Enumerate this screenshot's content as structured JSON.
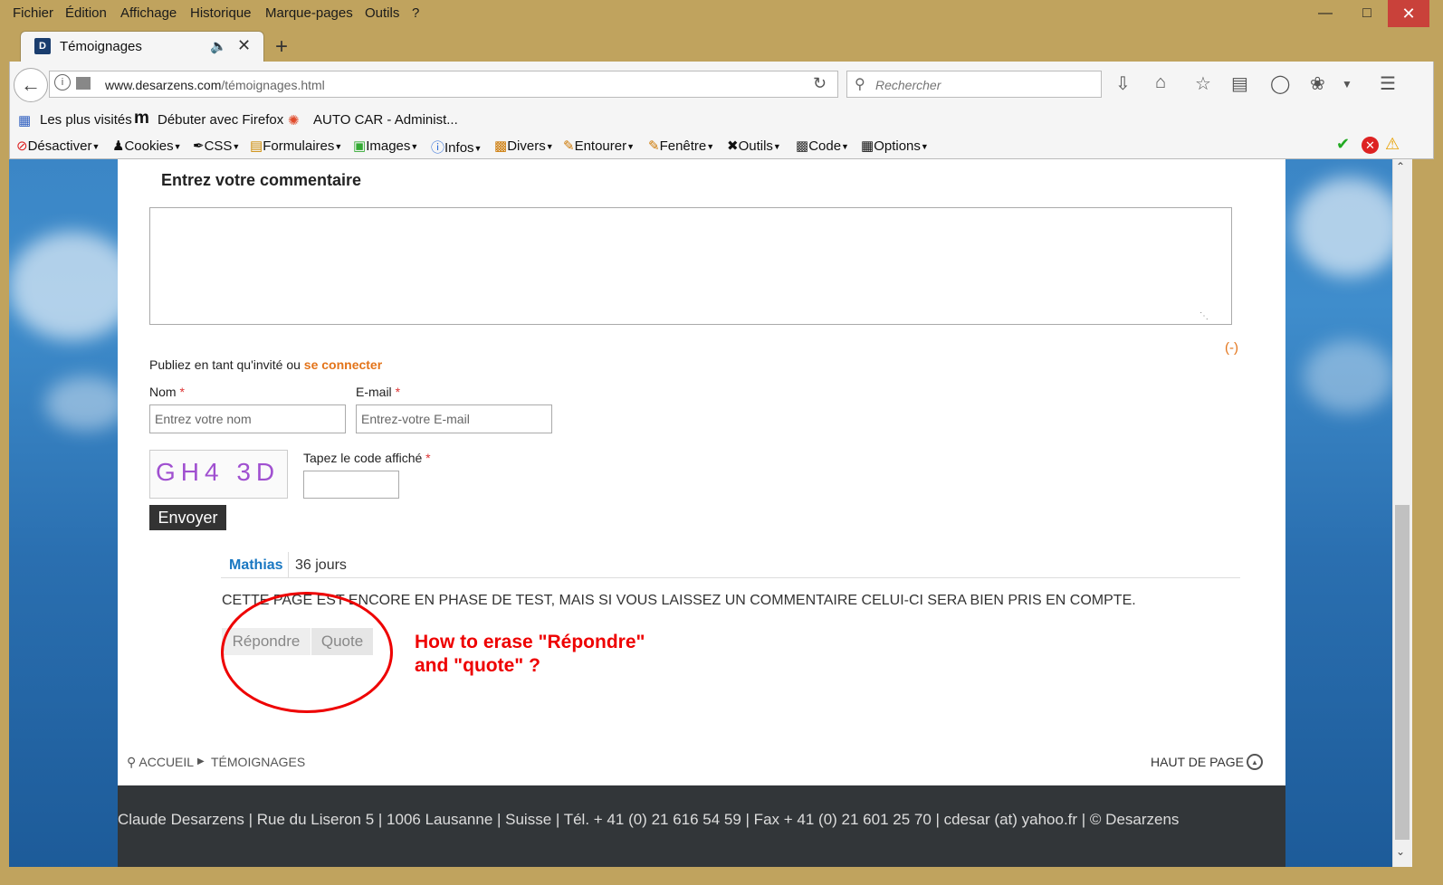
{
  "menu": [
    "Fichier",
    "Édition",
    "Affichage",
    "Historique",
    "Marque-pages",
    "Outils",
    "?"
  ],
  "tab": {
    "favicon": "D",
    "title": "Témoignages"
  },
  "url": {
    "domain": "www.desarzens.com",
    "path": "/témoignages.html"
  },
  "search": {
    "placeholder": "Rechercher"
  },
  "bookmarks": [
    "Les plus visités",
    "Débuter avec Firefox",
    "AUTO CAR - Administ..."
  ],
  "devbar": [
    "Désactiver",
    "Cookies",
    "CSS",
    "Formulaires",
    "Images",
    "Infos",
    "Divers",
    "Entourer",
    "Fenêtre",
    "Outils",
    "Code",
    "Options"
  ],
  "form": {
    "heading": "Entrez votre commentaire",
    "collapse": "(-)",
    "guest_text": "Publiez en tant qu'invité ou ",
    "login_link": "se connecter",
    "name_label": "Nom",
    "name_placeholder": "Entrez votre nom",
    "email_label": "E-mail",
    "email_placeholder": "Entrez-votre E-mail",
    "captcha_code": "GH4 3D",
    "captcha_label": "Tapez le code affiché",
    "required_mark": "*",
    "send": "Envoyer"
  },
  "comment": {
    "author": "Mathias",
    "age": "36 jours",
    "text": "CETTE PAGE EST ENCORE EN PHASE DE TEST, MAIS SI VOUS LAISSEZ UN COMMENTAIRE CELUI-CI SERA BIEN PRIS EN COMPTE.",
    "reply": "Répondre",
    "quote": "Quote"
  },
  "annotation": {
    "line1": "How to erase \"Répondre\"",
    "line2": "and \"quote\" ?"
  },
  "breadcrumb": {
    "home": "ACCUEIL",
    "current": "TÉMOIGNAGES",
    "top": "HAUT DE PAGE"
  },
  "footer": "Claude Desarzens | Rue du Liseron 5 | 1006 Lausanne | Suisse | Tél. + 41 (0) 21 616 54 59 | Fax + 41 (0) 21 601 25 70 | cdesar (at) yahoo.fr | © Desarzens",
  "colors": {
    "accent": "#e3741a",
    "author": "#1a78c2",
    "annotation": "#e00000",
    "footer_bg": "#323639"
  }
}
